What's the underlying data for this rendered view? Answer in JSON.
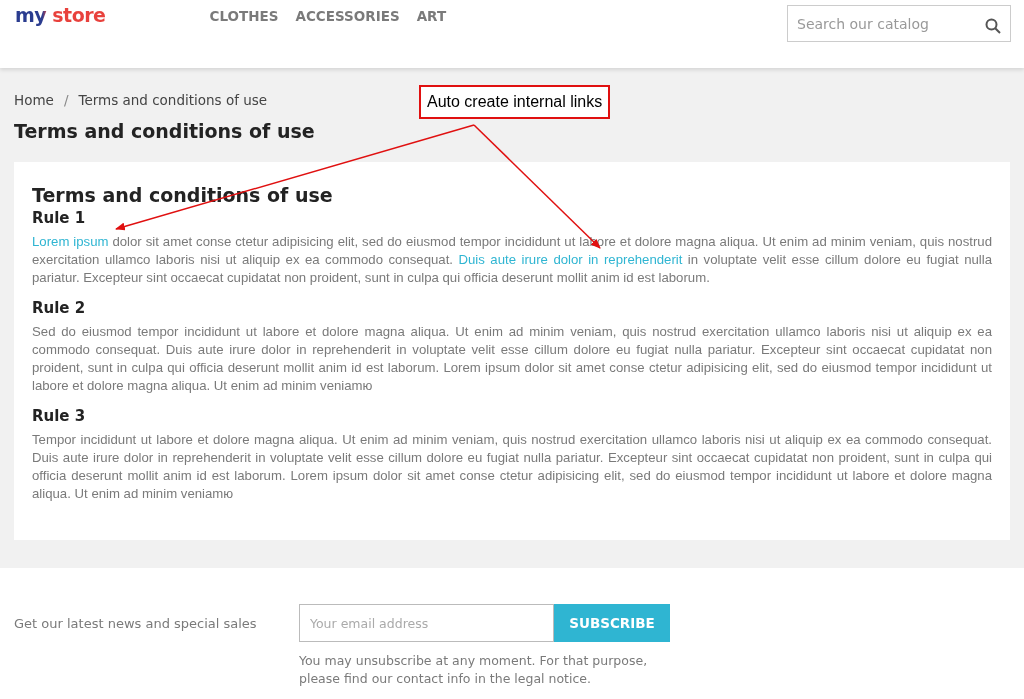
{
  "header": {
    "logo": "my store",
    "nav": [
      {
        "label": "CLOTHES"
      },
      {
        "label": "ACCESSORIES"
      },
      {
        "label": "ART"
      }
    ],
    "search": {
      "placeholder": "Search our catalog"
    }
  },
  "breadcrumb": [
    {
      "label": "Home"
    },
    {
      "label": "Terms and conditions of use"
    }
  ],
  "breadcrumb_separator": "/",
  "page_title": "Terms and conditions of use",
  "annotation": {
    "label": "Auto create internal links"
  },
  "content": {
    "title": "Terms and conditions of use",
    "rules": [
      {
        "heading": "Rule 1",
        "segments": [
          {
            "kind": "link",
            "text": "Lorem ipsum"
          },
          {
            "kind": "text",
            "text": " dolor sit amet conse ctetur adipisicing elit, sed do eiusmod tempor incididunt ut labore et dolore magna aliqua. Ut enim ad minim veniam, quis nostrud exercitation ullamco laboris nisi ut aliquip ex ea commodo consequat. "
          },
          {
            "kind": "link",
            "text": "Duis aute irure dolor in reprehenderit"
          },
          {
            "kind": "text",
            "text": " in voluptate velit esse cillum dolore eu fugiat nulla pariatur. Excepteur sint occaecat cupidatat non proident, sunt in culpa qui officia deserunt mollit anim id est laborum."
          }
        ]
      },
      {
        "heading": "Rule 2",
        "segments": [
          {
            "kind": "text",
            "text": "Sed do eiusmod tempor incididunt ut labore et dolore magna aliqua. Ut enim ad minim veniam, quis nostrud exercitation ullamco laboris nisi ut aliquip ex ea commodo consequat. Duis aute irure dolor in reprehenderit in voluptate velit esse cillum dolore eu fugiat nulla pariatur. Excepteur sint occaecat cupidatat non proident, sunt in culpa qui officia deserunt mollit anim id est laborum. Lorem ipsum dolor sit amet conse ctetur adipisicing elit, sed do eiusmod tempor incididunt ut labore et dolore magna aliqua. Ut enim ad minim veniamю"
          }
        ]
      },
      {
        "heading": "Rule 3",
        "segments": [
          {
            "kind": "text",
            "text": "Tempor incididunt ut labore et dolore magna aliqua. Ut enim ad minim veniam, quis nostrud exercitation ullamco laboris nisi ut aliquip ex ea commodo consequat. Duis aute irure dolor in reprehenderit in voluptate velit esse cillum dolore eu fugiat nulla pariatur. Excepteur sint occaecat cupidatat non proident, sunt in culpa qui officia deserunt mollit anim id est laborum. Lorem ipsum dolor sit amet conse ctetur adipisicing elit, sed do eiusmod tempor incididunt ut labore et dolore magna aliqua. Ut enim ad minim veniamю"
          }
        ]
      }
    ]
  },
  "newsletter": {
    "label": "Get our latest news and special sales",
    "email": {
      "placeholder": "Your email address"
    },
    "button": "SUBSCRIBE",
    "note": "You may unsubscribe at any moment. For that purpose, please find our contact info in the legal notice."
  }
}
